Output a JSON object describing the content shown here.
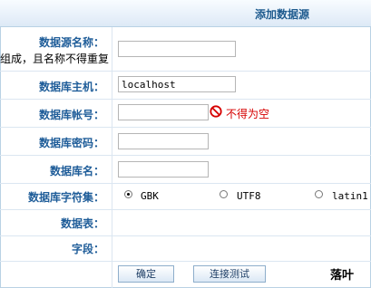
{
  "header": {
    "title": "添加数据源"
  },
  "fields": {
    "name": {
      "label": "数据源名称：",
      "hint": "组成，且名称不得重复",
      "value": ""
    },
    "host": {
      "label": "数据库主机：",
      "value": "localhost"
    },
    "user": {
      "label": "数据库帐号：",
      "value": "",
      "error": "不得为空"
    },
    "password": {
      "label": "数据库密码：",
      "value": ""
    },
    "dbname": {
      "label": "数据库名：",
      "value": ""
    },
    "charset": {
      "label": "数据库字符集：",
      "options": [
        "GBK",
        "UTF8",
        "latin1"
      ],
      "selected": "GBK"
    },
    "tables": {
      "label": "数据表："
    },
    "fields_label": {
      "label": "字段："
    }
  },
  "buttons": {
    "confirm": "确定",
    "test": "连接测试"
  },
  "brand": "落叶",
  "colors": {
    "label": "#1f5d99",
    "error": "#d60000",
    "header_title": "#1d5a8e"
  }
}
